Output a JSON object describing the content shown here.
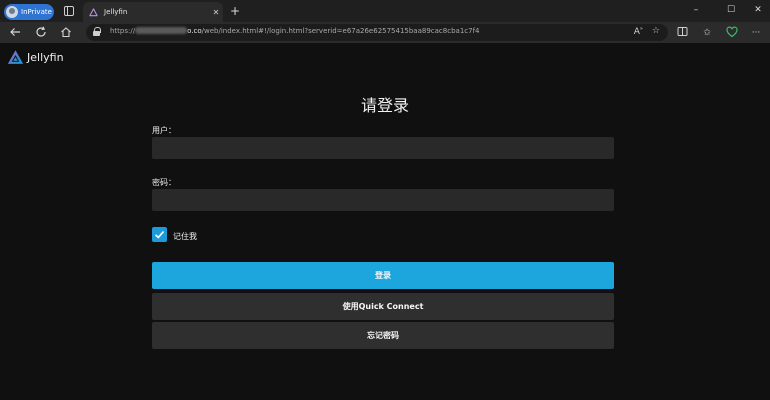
{
  "browser": {
    "inprivate_label": "InPrivate",
    "tab_title": "Jellyfin",
    "tab_close": "✕",
    "new_tab": "+",
    "window_controls": {
      "minimize": "–",
      "maximize": "☐",
      "close": "✕"
    },
    "url_prefix": "https://",
    "url_host_tail": "o.co",
    "url_path": "/web/index.html#!/login.html?serverid=e67a26e62575415baa89cac8cba1c7f4"
  },
  "app": {
    "brand": "Jellyfin",
    "accent": "#1ca6dd",
    "logo_colors": [
      "#aa5cc3",
      "#00a4dc"
    ]
  },
  "login": {
    "title": "请登录",
    "username_label": "用户：",
    "username_value": "",
    "password_label": "密码：",
    "password_value": "",
    "remember_label": "记住我",
    "remember_checked": true,
    "login_button": "登录",
    "quick_connect_button": "使用Quick Connect",
    "forgot_password_button": "忘记密码"
  },
  "icons": {
    "back": "back-arrow-icon",
    "refresh": "refresh-icon",
    "home": "home-icon",
    "lock": "lock-icon",
    "read_aloud": "read-aloud-icon",
    "favorite": "favorite-star-icon",
    "split_screen": "split-screen-icon",
    "favorites": "favorites-icon",
    "extension": "extension-icon",
    "more": "more-icon"
  }
}
